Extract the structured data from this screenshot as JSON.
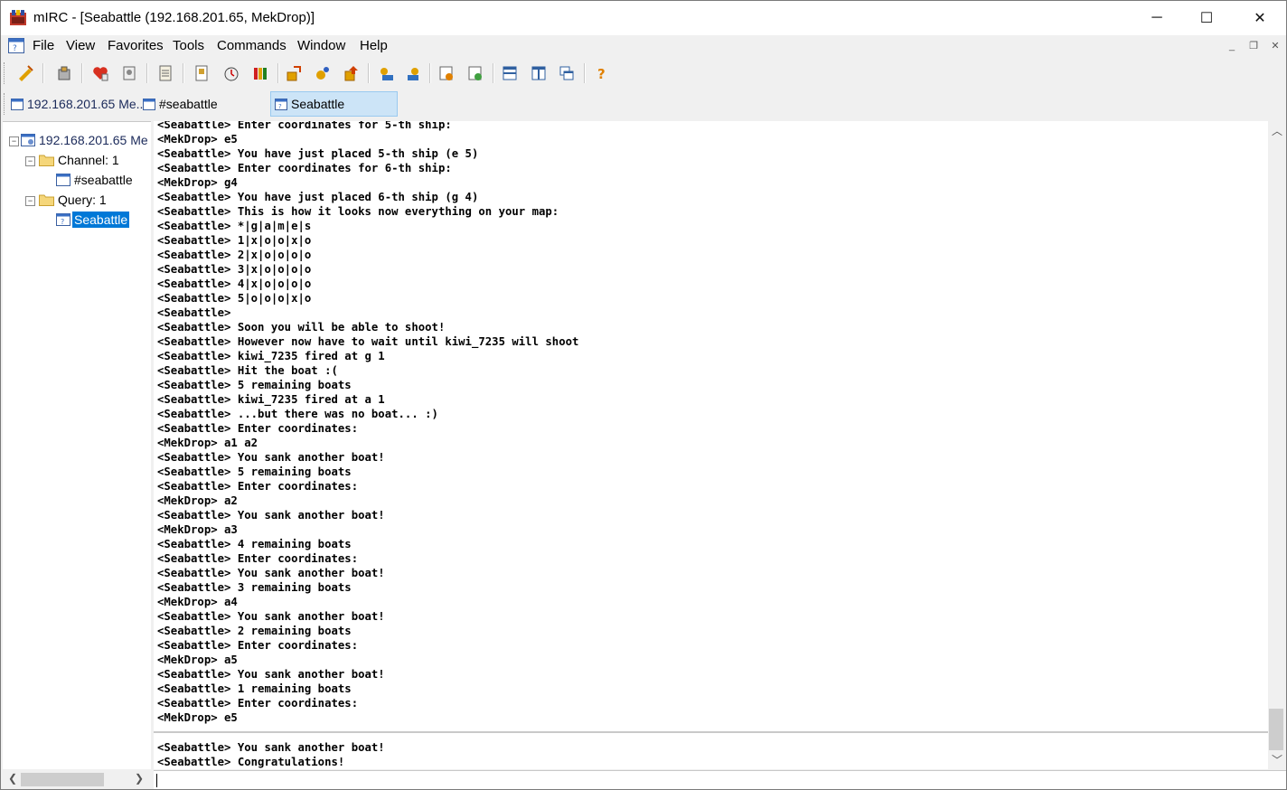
{
  "window": {
    "title": "mIRC - [Seabattle (192.168.201.65, MekDrop)]",
    "controls": {
      "minimize": "─",
      "maximize": "☐",
      "close": "✕"
    }
  },
  "menubar": {
    "items": [
      "File",
      "View",
      "Favorites",
      "Tools",
      "Commands",
      "Window",
      "Help"
    ],
    "mdi_controls": {
      "minimize": "_",
      "restore": "❐",
      "close": "✕"
    }
  },
  "toolbar": {
    "buttons": [
      "connect-icon",
      "options-icon",
      "favorites-icon",
      "address-book-icon",
      "log-icon",
      "dcc-icon",
      "timer-icon",
      "colors-icon",
      "channels-list-icon",
      "notify-icon",
      "urls-icon",
      "dcc-send-icon",
      "dcc-chat-icon",
      "scripts-icon",
      "tile-horizontal-icon",
      "tile-vertical-icon",
      "cascade-icon",
      "help-icon"
    ]
  },
  "switchbar": {
    "tabs": [
      {
        "label": "192.168.201.65 Me...",
        "active": false
      },
      {
        "label": "#seabattle",
        "active": false
      },
      {
        "label": "Seabattle",
        "active": true
      }
    ]
  },
  "treebar": {
    "server": "192.168.201.65 Me",
    "channel_group": "Channel: 1",
    "channel_item": "#seabattle",
    "query_group": "Query: 1",
    "query_item": "Seabattle",
    "expander_minus": "−"
  },
  "chat": {
    "lines": [
      "<Seabattle> Enter coordinates for 5-th ship:",
      "<MekDrop> e5",
      "<Seabattle> You have just placed 5-th ship (e 5)",
      "<Seabattle> Enter coordinates for 6-th ship:",
      "<MekDrop> g4",
      "<Seabattle> You have just placed 6-th ship (g 4)",
      "<Seabattle> This is how it looks now everything on your map:",
      "<Seabattle> *|g|a|m|e|s",
      "<Seabattle> 1|x|o|o|x|o",
      "<Seabattle> 2|x|o|o|o|o",
      "<Seabattle> 3|x|o|o|o|o",
      "<Seabattle> 4|x|o|o|o|o",
      "<Seabattle> 5|o|o|o|x|o",
      "<Seabattle>",
      "<Seabattle> Soon you will be able to shoot!",
      "<Seabattle> However now have to wait until kiwi_7235 will shoot",
      "<Seabattle> kiwi_7235 fired at g 1",
      "<Seabattle> Hit the boat :(",
      "<Seabattle> 5 remaining boats",
      "<Seabattle> kiwi_7235 fired at a 1",
      "<Seabattle> ...but there was no boat... :)",
      "<Seabattle> Enter coordinates:",
      "<MekDrop> a1 a2",
      "<Seabattle> You sank another boat!",
      "<Seabattle> 5 remaining boats",
      "<Seabattle> Enter coordinates:",
      "<MekDrop> a2",
      "<Seabattle> You sank another boat!",
      "<MekDrop> a3",
      "<Seabattle> 4 remaining boats",
      "<Seabattle> Enter coordinates:",
      "<Seabattle> You sank another boat!",
      "<Seabattle> 3 remaining boats",
      "<MekDrop> a4",
      "<Seabattle> You sank another boat!",
      "<Seabattle> 2 remaining boats",
      "<Seabattle> Enter coordinates:",
      "<MekDrop> a5",
      "<Seabattle> You sank another boat!",
      "<Seabattle> 1 remaining boats",
      "<Seabattle> Enter coordinates:",
      "<MekDrop> e5"
    ],
    "lines_after_marker": [
      "<Seabattle> You sank another boat!",
      "<Seabattle> Congratulations!"
    ]
  },
  "editbox": {
    "value": ""
  },
  "scroll_arrows": {
    "up": "︿",
    "down": "﹀",
    "left": "❮",
    "right": "❯"
  }
}
